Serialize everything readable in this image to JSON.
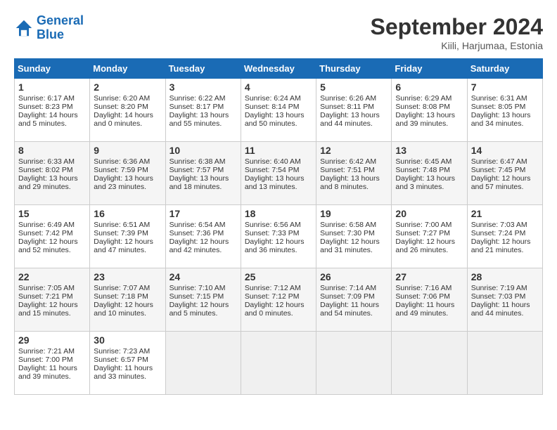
{
  "header": {
    "logo_line1": "General",
    "logo_line2": "Blue",
    "month_title": "September 2024",
    "location": "Kiili, Harjumaa, Estonia"
  },
  "days_of_week": [
    "Sunday",
    "Monday",
    "Tuesday",
    "Wednesday",
    "Thursday",
    "Friday",
    "Saturday"
  ],
  "weeks": [
    [
      {
        "day": "1",
        "sunrise": "6:17 AM",
        "sunset": "8:23 PM",
        "daylight": "14 hours and 5 minutes."
      },
      {
        "day": "2",
        "sunrise": "6:20 AM",
        "sunset": "8:20 PM",
        "daylight": "14 hours and 0 minutes."
      },
      {
        "day": "3",
        "sunrise": "6:22 AM",
        "sunset": "8:17 PM",
        "daylight": "13 hours and 55 minutes."
      },
      {
        "day": "4",
        "sunrise": "6:24 AM",
        "sunset": "8:14 PM",
        "daylight": "13 hours and 50 minutes."
      },
      {
        "day": "5",
        "sunrise": "6:26 AM",
        "sunset": "8:11 PM",
        "daylight": "13 hours and 44 minutes."
      },
      {
        "day": "6",
        "sunrise": "6:29 AM",
        "sunset": "8:08 PM",
        "daylight": "13 hours and 39 minutes."
      },
      {
        "day": "7",
        "sunrise": "6:31 AM",
        "sunset": "8:05 PM",
        "daylight": "13 hours and 34 minutes."
      }
    ],
    [
      {
        "day": "8",
        "sunrise": "6:33 AM",
        "sunset": "8:02 PM",
        "daylight": "13 hours and 29 minutes."
      },
      {
        "day": "9",
        "sunrise": "6:36 AM",
        "sunset": "7:59 PM",
        "daylight": "13 hours and 23 minutes."
      },
      {
        "day": "10",
        "sunrise": "6:38 AM",
        "sunset": "7:57 PM",
        "daylight": "13 hours and 18 minutes."
      },
      {
        "day": "11",
        "sunrise": "6:40 AM",
        "sunset": "7:54 PM",
        "daylight": "13 hours and 13 minutes."
      },
      {
        "day": "12",
        "sunrise": "6:42 AM",
        "sunset": "7:51 PM",
        "daylight": "13 hours and 8 minutes."
      },
      {
        "day": "13",
        "sunrise": "6:45 AM",
        "sunset": "7:48 PM",
        "daylight": "13 hours and 3 minutes."
      },
      {
        "day": "14",
        "sunrise": "6:47 AM",
        "sunset": "7:45 PM",
        "daylight": "12 hours and 57 minutes."
      }
    ],
    [
      {
        "day": "15",
        "sunrise": "6:49 AM",
        "sunset": "7:42 PM",
        "daylight": "12 hours and 52 minutes."
      },
      {
        "day": "16",
        "sunrise": "6:51 AM",
        "sunset": "7:39 PM",
        "daylight": "12 hours and 47 minutes."
      },
      {
        "day": "17",
        "sunrise": "6:54 AM",
        "sunset": "7:36 PM",
        "daylight": "12 hours and 42 minutes."
      },
      {
        "day": "18",
        "sunrise": "6:56 AM",
        "sunset": "7:33 PM",
        "daylight": "12 hours and 36 minutes."
      },
      {
        "day": "19",
        "sunrise": "6:58 AM",
        "sunset": "7:30 PM",
        "daylight": "12 hours and 31 minutes."
      },
      {
        "day": "20",
        "sunrise": "7:00 AM",
        "sunset": "7:27 PM",
        "daylight": "12 hours and 26 minutes."
      },
      {
        "day": "21",
        "sunrise": "7:03 AM",
        "sunset": "7:24 PM",
        "daylight": "12 hours and 21 minutes."
      }
    ],
    [
      {
        "day": "22",
        "sunrise": "7:05 AM",
        "sunset": "7:21 PM",
        "daylight": "12 hours and 15 minutes."
      },
      {
        "day": "23",
        "sunrise": "7:07 AM",
        "sunset": "7:18 PM",
        "daylight": "12 hours and 10 minutes."
      },
      {
        "day": "24",
        "sunrise": "7:10 AM",
        "sunset": "7:15 PM",
        "daylight": "12 hours and 5 minutes."
      },
      {
        "day": "25",
        "sunrise": "7:12 AM",
        "sunset": "7:12 PM",
        "daylight": "12 hours and 0 minutes."
      },
      {
        "day": "26",
        "sunrise": "7:14 AM",
        "sunset": "7:09 PM",
        "daylight": "11 hours and 54 minutes."
      },
      {
        "day": "27",
        "sunrise": "7:16 AM",
        "sunset": "7:06 PM",
        "daylight": "11 hours and 49 minutes."
      },
      {
        "day": "28",
        "sunrise": "7:19 AM",
        "sunset": "7:03 PM",
        "daylight": "11 hours and 44 minutes."
      }
    ],
    [
      {
        "day": "29",
        "sunrise": "7:21 AM",
        "sunset": "7:00 PM",
        "daylight": "11 hours and 39 minutes."
      },
      {
        "day": "30",
        "sunrise": "7:23 AM",
        "sunset": "6:57 PM",
        "daylight": "11 hours and 33 minutes."
      },
      null,
      null,
      null,
      null,
      null
    ]
  ]
}
